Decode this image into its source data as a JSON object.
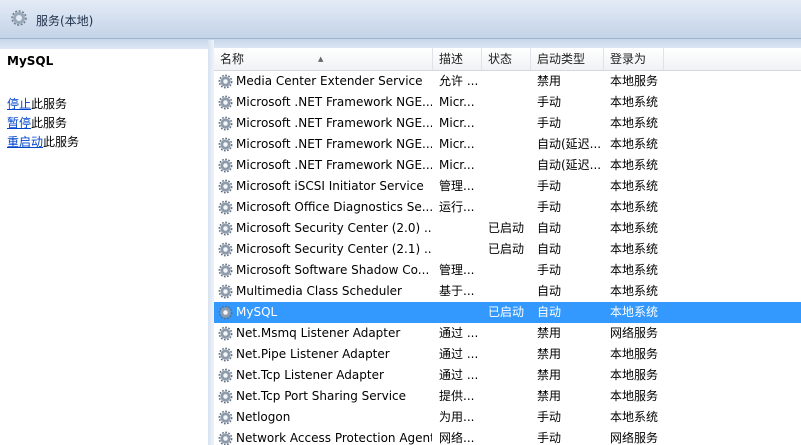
{
  "window": {
    "title": "服务(本地)"
  },
  "left_pane": {
    "service_name": "MySQL",
    "actions": [
      {
        "link": "停止",
        "suffix": "此服务"
      },
      {
        "link": "暂停",
        "suffix": "此服务"
      },
      {
        "link": "重启动",
        "suffix": "此服务"
      }
    ]
  },
  "table": {
    "columns": {
      "name": "名称",
      "desc": "描述",
      "status": "状态",
      "startup": "启动类型",
      "login": "登录为"
    },
    "rows": [
      {
        "name": "Media Center Extender Service",
        "desc": "允许 ...",
        "status": "",
        "startup": "禁用",
        "login": "本地服务"
      },
      {
        "name": "Microsoft .NET Framework NGE...",
        "desc": "Micr...",
        "status": "",
        "startup": "手动",
        "login": "本地系统"
      },
      {
        "name": "Microsoft .NET Framework NGE...",
        "desc": "Micr...",
        "status": "",
        "startup": "手动",
        "login": "本地系统"
      },
      {
        "name": "Microsoft .NET Framework NGE...",
        "desc": "Micr...",
        "status": "",
        "startup": "自动(延迟...",
        "login": "本地系统"
      },
      {
        "name": "Microsoft .NET Framework NGE...",
        "desc": "Micr...",
        "status": "",
        "startup": "自动(延迟...",
        "login": "本地系统"
      },
      {
        "name": "Microsoft iSCSI Initiator Service",
        "desc": "管理...",
        "status": "",
        "startup": "手动",
        "login": "本地系统"
      },
      {
        "name": "Microsoft Office Diagnostics Se...",
        "desc": "运行...",
        "status": "",
        "startup": "手动",
        "login": "本地系统"
      },
      {
        "name": "Microsoft Security Center (2.0) ...",
        "desc": "",
        "status": "已启动",
        "startup": "自动",
        "login": "本地系统"
      },
      {
        "name": "Microsoft Security Center (2.1) ...",
        "desc": "",
        "status": "已启动",
        "startup": "自动",
        "login": "本地系统"
      },
      {
        "name": "Microsoft Software Shadow Co...",
        "desc": "管理...",
        "status": "",
        "startup": "手动",
        "login": "本地系统"
      },
      {
        "name": "Multimedia Class Scheduler",
        "desc": "基于...",
        "status": "",
        "startup": "自动",
        "login": "本地系统"
      },
      {
        "name": "MySQL",
        "desc": "",
        "status": "已启动",
        "startup": "自动",
        "login": "本地系统"
      },
      {
        "name": "Net.Msmq Listener Adapter",
        "desc": "通过 ...",
        "status": "",
        "startup": "禁用",
        "login": "网络服务"
      },
      {
        "name": "Net.Pipe Listener Adapter",
        "desc": "通过 ...",
        "status": "",
        "startup": "禁用",
        "login": "本地服务"
      },
      {
        "name": "Net.Tcp Listener Adapter",
        "desc": "通过 ...",
        "status": "",
        "startup": "禁用",
        "login": "本地服务"
      },
      {
        "name": "Net.Tcp Port Sharing Service",
        "desc": "提供...",
        "status": "",
        "startup": "禁用",
        "login": "本地服务"
      },
      {
        "name": "Netlogon",
        "desc": "为用...",
        "status": "",
        "startup": "手动",
        "login": "本地系统"
      },
      {
        "name": "Network Access Protection Agent",
        "desc": "网络...",
        "status": "",
        "startup": "手动",
        "login": "网络服务"
      }
    ],
    "selected_index": 11
  },
  "colors": {
    "selection": "#3399ff",
    "link": "#0044cc",
    "header_bg": "#c4d3e8"
  },
  "icons": {
    "window": "gear-services-icon",
    "row": "gear-icon"
  }
}
